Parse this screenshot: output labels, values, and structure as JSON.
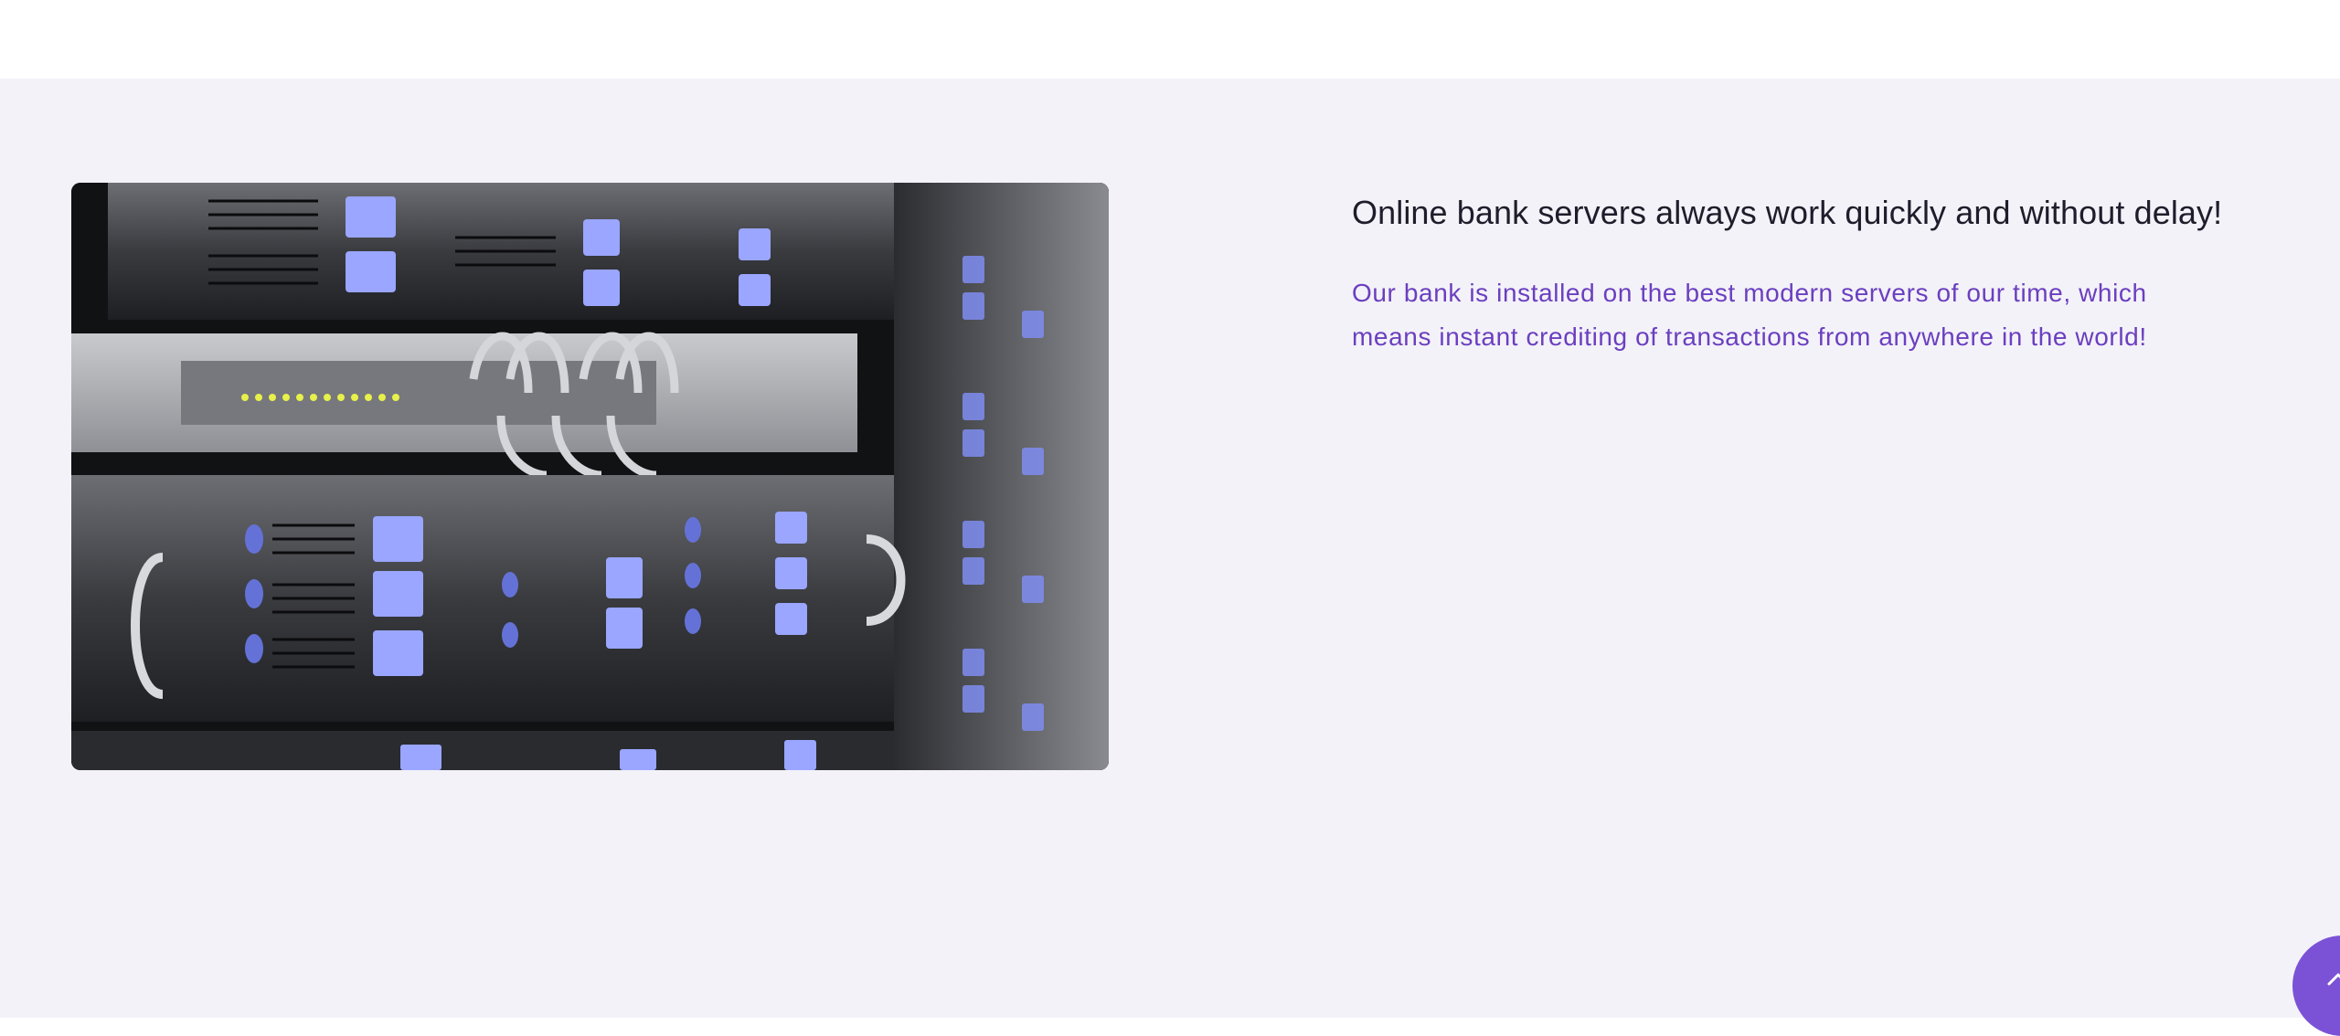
{
  "feature": {
    "title": "Online bank servers always work quickly and without delay!",
    "description": "Our bank is installed on the best modern servers of our time, which means instant crediting of transactions from anywhere in the world!",
    "image_icon": "server-rack-photo"
  },
  "scroll_top": {
    "icon": "chevron-up-icon"
  },
  "colors": {
    "section_bg": "#f3f2f8",
    "title": "#1f1d2b",
    "accent": "#6b3fc0",
    "button": "#7b52d6"
  }
}
